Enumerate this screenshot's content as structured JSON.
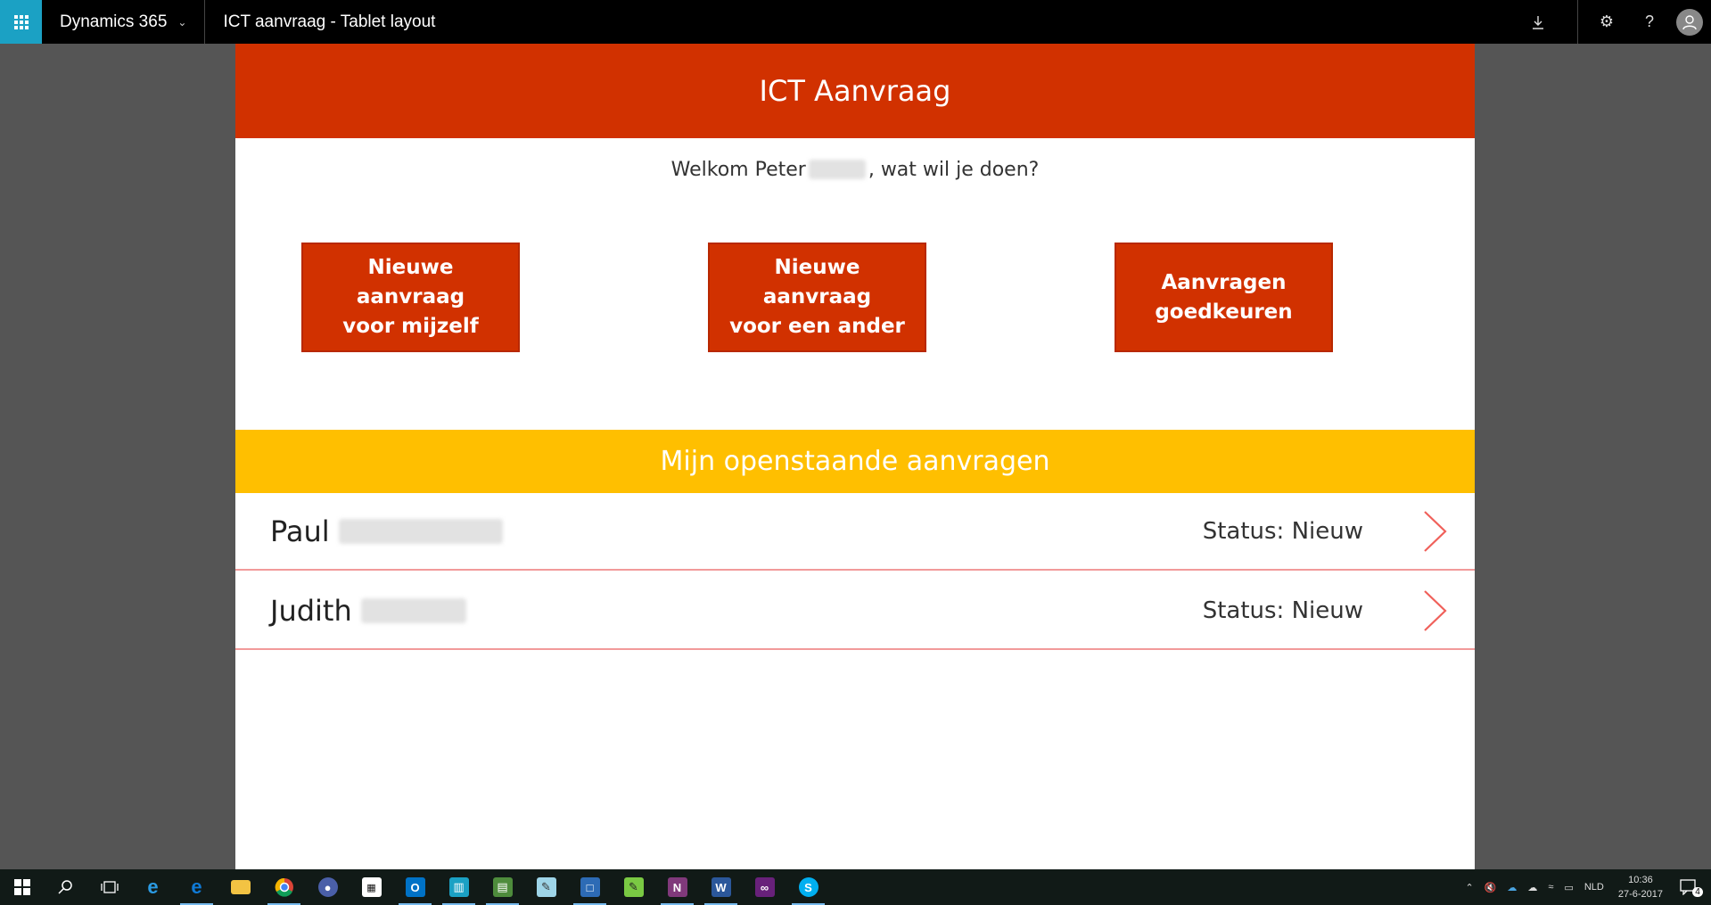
{
  "topbar": {
    "brand": "Dynamics 365",
    "app_title": "ICT aanvraag - Tablet layout"
  },
  "app": {
    "header_title": "ICT Aanvraag",
    "welcome_prefix": "Welkom Peter",
    "welcome_suffix": ", wat wil je doen?",
    "buttons": [
      {
        "line1": "Nieuwe aanvraag",
        "line2": "voor mijzelf"
      },
      {
        "line1": "Nieuwe aanvraag",
        "line2": "voor een ander"
      },
      {
        "line1": "Aanvragen",
        "line2": "goedkeuren"
      }
    ],
    "section_title": "Mijn openstaande aanvragen",
    "requests": [
      {
        "name": "Paul",
        "status": "Status: Nieuw"
      },
      {
        "name": "Judith",
        "status": "Status: Nieuw"
      }
    ]
  },
  "colors": {
    "header": "#d13100",
    "section": "#ffbf00",
    "accent": "#1ba1c4",
    "divider": "#f29a9a"
  },
  "taskbar": {
    "language": "NLD",
    "time": "10:36",
    "date": "27-6-2017",
    "notification_count": "4"
  }
}
